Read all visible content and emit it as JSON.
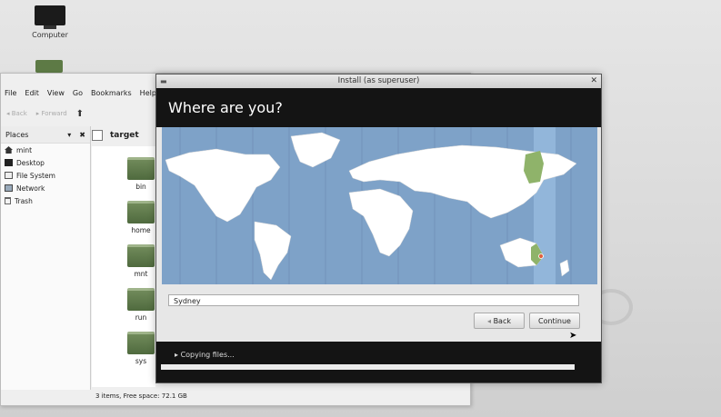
{
  "desktop": {
    "icons": [
      {
        "label": "Computer",
        "icon": "computer-icon"
      }
    ]
  },
  "file_manager": {
    "menu": [
      "File",
      "Edit",
      "View",
      "Go",
      "Bookmarks",
      "Help"
    ],
    "toolbar": {
      "back": "Back",
      "forward": "Forward"
    },
    "places_header": "Places",
    "places": [
      {
        "label": "mint",
        "icon": "home-icon"
      },
      {
        "label": "Desktop",
        "icon": "desktop-icon"
      },
      {
        "label": "File System",
        "icon": "drive-icon"
      },
      {
        "label": "Network",
        "icon": "network-icon"
      },
      {
        "label": "Trash",
        "icon": "trash-icon"
      }
    ],
    "path": "target",
    "folders": [
      "bin",
      "home",
      "mnt",
      "run",
      "sys"
    ],
    "status": "3 items, Free space: 72.1 GB"
  },
  "installer": {
    "title": "Install (as superuser)",
    "heading": "Where are you?",
    "city_value": "Sydney",
    "back_label": "Back",
    "continue_label": "Continue",
    "progress_text": "Copying files...",
    "progress_fraction": 0.99,
    "colors": {
      "header": "#141414",
      "ocean": "#7ea2c8",
      "selected_zone": "#8fb36a"
    }
  }
}
